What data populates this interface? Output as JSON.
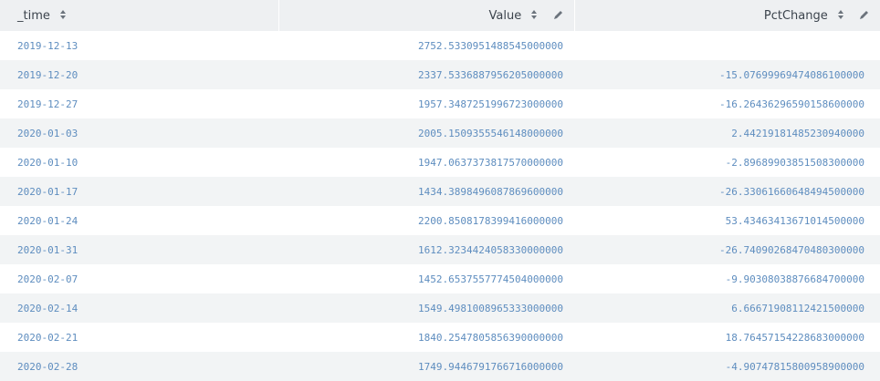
{
  "table": {
    "columns": [
      {
        "label": "_time",
        "sortable": true,
        "editable": false
      },
      {
        "label": "Value",
        "sortable": true,
        "editable": true
      },
      {
        "label": "PctChange",
        "sortable": true,
        "editable": true
      }
    ],
    "rows": [
      {
        "time": "2019-12-13",
        "value": "2752.5330951488545000000",
        "pct": ""
      },
      {
        "time": "2019-12-20",
        "value": "2337.5336887956205000000",
        "pct": "-15.07699969474086100000"
      },
      {
        "time": "2019-12-27",
        "value": "1957.3487251996723000000",
        "pct": "-16.26436296590158600000"
      },
      {
        "time": "2020-01-03",
        "value": "2005.1509355546148000000",
        "pct": "2.44219181485230940000"
      },
      {
        "time": "2020-01-10",
        "value": "1947.0637373817570000000",
        "pct": "-2.89689903851508300000"
      },
      {
        "time": "2020-01-17",
        "value": "1434.3898496087869600000",
        "pct": "-26.33061660648494500000"
      },
      {
        "time": "2020-01-24",
        "value": "2200.8508178399416000000",
        "pct": "53.43463413671014500000"
      },
      {
        "time": "2020-01-31",
        "value": "1612.3234424058330000000",
        "pct": "-26.74090268470480300000"
      },
      {
        "time": "2020-02-07",
        "value": "1452.6537557774504000000",
        "pct": "-9.90308038876684700000"
      },
      {
        "time": "2020-02-14",
        "value": "1549.4981008965333000000",
        "pct": "6.66671908112421500000"
      },
      {
        "time": "2020-02-21",
        "value": "1840.2547805856390000000",
        "pct": "18.76457154228683000000"
      },
      {
        "time": "2020-02-28",
        "value": "1749.9446791766716000000",
        "pct": "-4.90747815800958900000"
      }
    ]
  },
  "colors": {
    "header_bg": "#eef0f2",
    "header_text": "#3c444d",
    "cell_text": "#5e8dbf",
    "stripe_bg": "#f2f4f5",
    "icon": "#6b737c"
  }
}
